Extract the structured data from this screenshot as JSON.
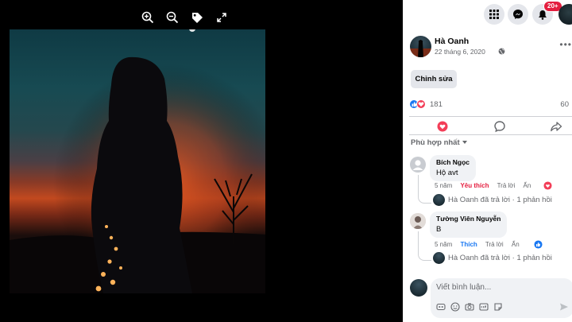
{
  "post": {
    "author": "Hà Oanh",
    "date": "22 tháng 6, 2020",
    "edit_label": "Chỉnh sửa",
    "reaction_count": "181",
    "comment_count_partial": "60"
  },
  "topbar": {
    "notification_badge": "20+"
  },
  "comments": {
    "sort_label": "Phù hợp nhất",
    "items": [
      {
        "name": "Bích Ngọc",
        "text": "Hộ avt",
        "time": "5 năm",
        "like": "Yêu thích",
        "reply": "Trả lời",
        "hide": "Ẩn",
        "reply_summary": "Hà Oanh đã trả lời · 1 phản hồi"
      },
      {
        "name": "Tường Viên Nguyễn",
        "text": "B",
        "time": "5 năm",
        "like": "Thích",
        "reply": "Trả lời",
        "hide": "Ẩn",
        "reply_summary": "Hà Oanh đã trả lời · 1 phản hồi"
      }
    ]
  },
  "composer": {
    "placeholder": "Viết bình luận..."
  },
  "colors": {
    "like_blue": "#1877f2",
    "love_red": "#f33e58",
    "badge_red": "#e41e3f",
    "panel_bg": "#ffffff",
    "viewer_bg": "#000000"
  },
  "icons": {
    "viewer": [
      "zoom-in-icon",
      "zoom-out-icon",
      "tag-icon",
      "fullscreen-icon"
    ],
    "topbar": [
      "menu-grid-icon",
      "messenger-icon",
      "bell-icon"
    ],
    "actions": [
      "love-icon",
      "comment-icon",
      "share-icon"
    ],
    "composer": [
      "gif-icon",
      "emoji-icon",
      "camera-icon",
      "gif-icon",
      "sticker-icon",
      "send-icon"
    ]
  }
}
